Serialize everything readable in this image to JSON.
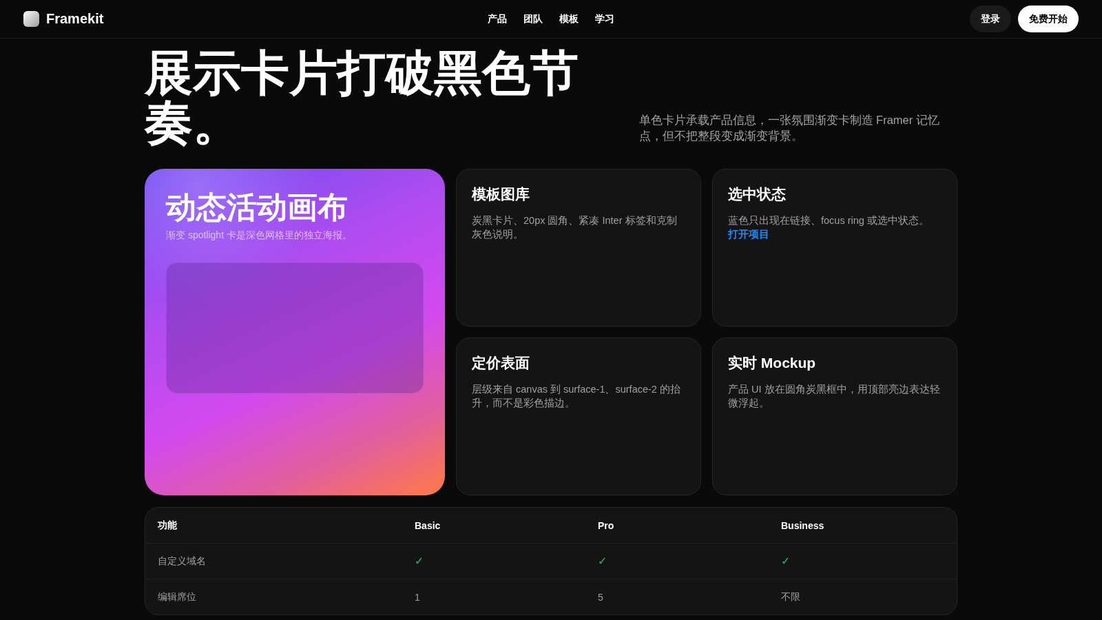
{
  "nav": {
    "brand": "Framekit",
    "links": [
      "产品",
      "团队",
      "模板",
      "学习"
    ],
    "login": "登录",
    "cta": "免费开始"
  },
  "hero": {
    "title": "展示卡片打破黑色节奏。",
    "subtitle": "单色卡片承载产品信息，一张氛围渐变卡制造 Framer 记忆点，但不把整段变成渐变背景。"
  },
  "spotlight": {
    "title": "动态活动画布",
    "subtitle": "渐变 spotlight 卡是深色网格里的独立海报。"
  },
  "cards": [
    {
      "title": "模板图库",
      "body": "炭黑卡片、20px 圆角、紧凑 Inter 标签和克制灰色说明。"
    },
    {
      "title": "选中状态",
      "body": "蓝色只出现在链接、focus ring 或选中状态。",
      "link": "打开项目"
    },
    {
      "title": "定价表面",
      "body": "层级来自 canvas 到 surface-1、surface-2 的抬升，而不是彩色描边。"
    },
    {
      "title": "实时 Mockup",
      "body": "产品 UI 放在圆角炭黑框中，用顶部亮边表达轻微浮起。"
    }
  ],
  "table": {
    "columns": [
      "功能",
      "Basic",
      "Pro",
      "Business"
    ],
    "rows": [
      {
        "cells": [
          {
            "kind": "text",
            "text": "自定义域名"
          },
          {
            "kind": "check",
            "text": "✓"
          },
          {
            "kind": "check",
            "text": "✓"
          },
          {
            "kind": "check",
            "text": "✓"
          }
        ]
      },
      {
        "cells": [
          {
            "kind": "text",
            "text": "编辑席位"
          },
          {
            "kind": "text",
            "text": "1"
          },
          {
            "kind": "text",
            "text": "5"
          },
          {
            "kind": "text",
            "text": "不限"
          }
        ]
      }
    ]
  }
}
